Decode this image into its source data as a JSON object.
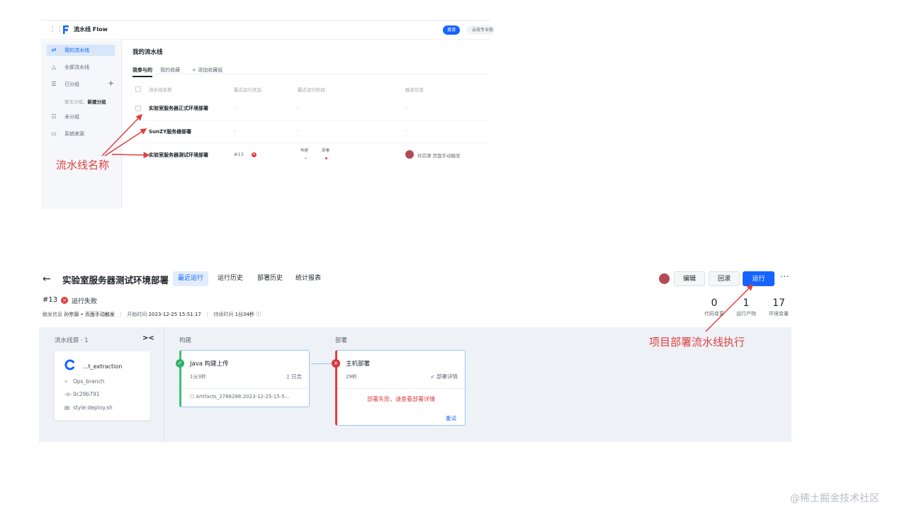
{
  "top": {
    "app_title": "流水线 Flow",
    "invite_label": "邀请",
    "cloud_label": "云效专业版",
    "sidebar": {
      "items": [
        {
          "icon": "pipeline-icon",
          "label": "我的流水线"
        },
        {
          "icon": "all-pipelines-icon",
          "label": "全部流水线"
        },
        {
          "icon": "grouped-icon",
          "label": "已分组"
        },
        {
          "icon": "ungrouped-icon",
          "label": "未分组"
        },
        {
          "icon": "system-source-icon",
          "label": "系统来源"
        }
      ],
      "empty_hint": "暂无分组，",
      "new_group": "新建分组"
    },
    "main_title": "我的流水线",
    "tabs": [
      "我参与的",
      "我的收藏",
      "+ 添加收藏组"
    ],
    "columns": [
      "流水线名称",
      "最近运行状态",
      "最近运行阶段",
      "触发信息"
    ],
    "rows": [
      {
        "name": "实验室服务器正式环境部署",
        "status": "-",
        "stage": "-",
        "trigger": "-"
      },
      {
        "name": "SunZY服务器部署",
        "status": "-",
        "stage": "-",
        "trigger": "-"
      },
      {
        "name": "实验室服务器测试环境部署",
        "run": "#13",
        "stages": [
          "构建",
          "部署"
        ],
        "trigger": "孙宗源 页面手动触发"
      }
    ]
  },
  "annotations": {
    "pipeline_name": "流水线名称",
    "run_pipeline": "项目部署流水线执行"
  },
  "detail": {
    "title": "实验室服务器测试环境部署",
    "tabs": [
      "最近运行",
      "运行历史",
      "部署历史",
      "统计报表"
    ],
    "edit_label": "编辑",
    "rollback_label": "回滚",
    "run_label": "运行",
    "more_label": "···",
    "build_num": "#13",
    "build_status": "运行失败",
    "meta": {
      "trigger_label": "触发信息",
      "trigger_value": "孙宗源 • 页面手动触发",
      "start_label": "开始时间",
      "start_value": "2023-12-25 15:51:17",
      "duration_label": "持续时间",
      "duration_value": "1分34秒"
    },
    "stats": [
      {
        "value": "0",
        "label": "代码变更"
      },
      {
        "value": "1",
        "label": "运行产物"
      },
      {
        "value": "17",
        "label": "环境变量"
      }
    ],
    "source": {
      "title": "流水线源 · 1",
      "repo": "...t_extraction",
      "branch": "Ops_branch",
      "commit": "0c29b791",
      "file": "style:deploy.sh"
    },
    "stages": [
      {
        "title": "构建",
        "job": "Java 构建上传",
        "time": "1分3秒",
        "link": "日志",
        "artifact": "Artifacts_2788288:2023-12-25-15-5..."
      },
      {
        "title": "部署",
        "job": "主机部署",
        "time": "29秒",
        "link": "部署详情",
        "error": "部署失败，请查看部署详情",
        "retry": "重试"
      }
    ]
  },
  "watermark": "@稀土掘金技术社区",
  "colors": {
    "primary": "#1664ff",
    "error": "#e03e3e",
    "success": "#2fb368",
    "annotation": "#e03e3e"
  }
}
